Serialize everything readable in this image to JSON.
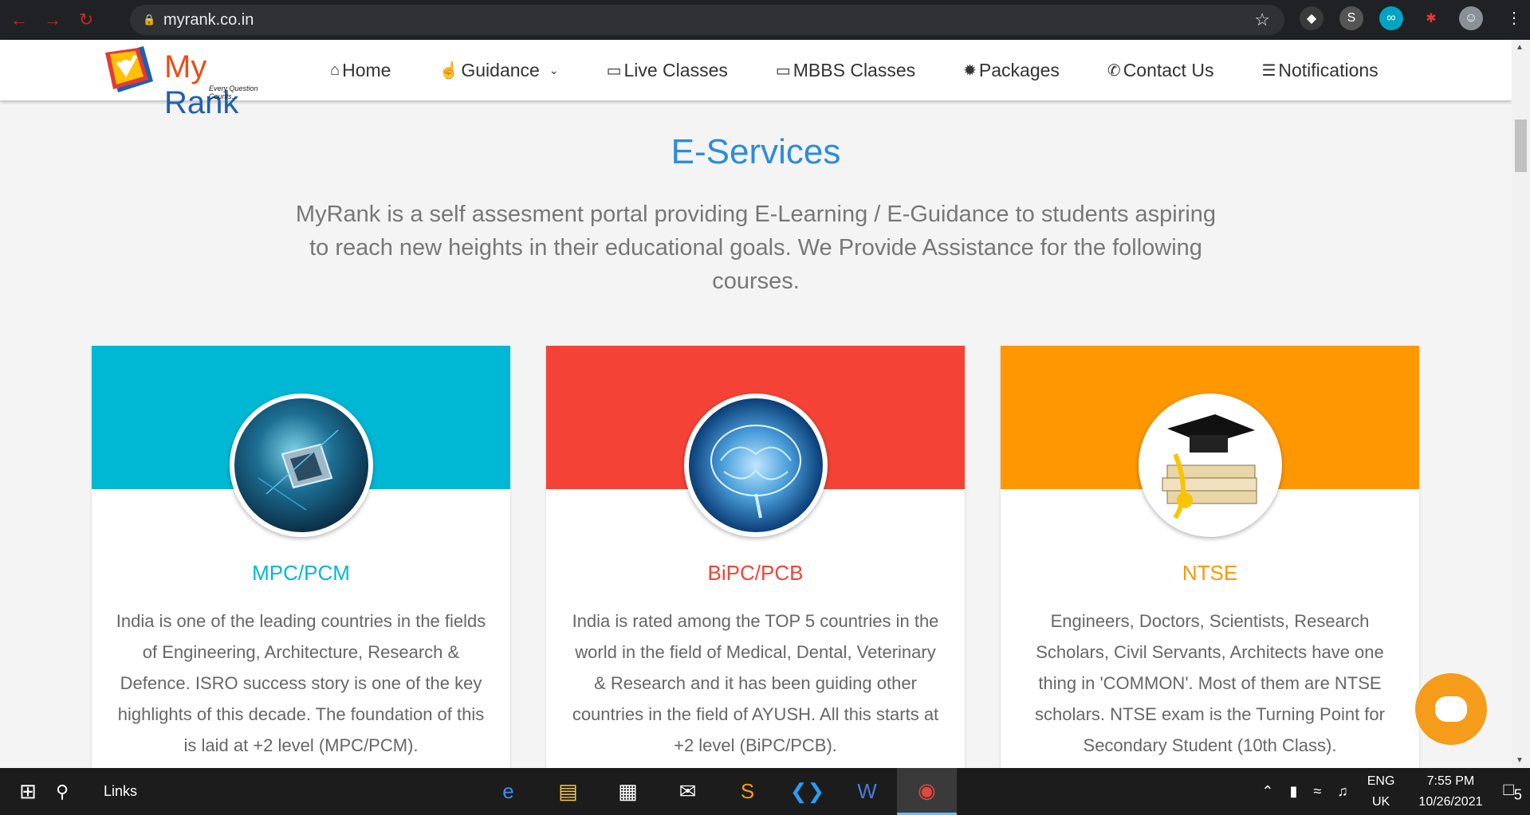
{
  "browser": {
    "url": "myrank.co.in"
  },
  "site": {
    "logo_my": "My",
    "logo_rank": "Rank",
    "logo_tagline": "Every Question Counts...",
    "menu": [
      {
        "label": "Home",
        "icon": "home-icon"
      },
      {
        "label": "Guidance",
        "icon": "thumbs-up-icon"
      },
      {
        "label": "Live Classes",
        "icon": "monitor-icon"
      },
      {
        "label": "MBBS Classes",
        "icon": "monitor-icon"
      },
      {
        "label": "Packages",
        "icon": "gear-icon"
      },
      {
        "label": "Contact Us",
        "icon": "phone-icon"
      },
      {
        "label": "Notifications",
        "icon": "list-icon"
      }
    ]
  },
  "main": {
    "heading": "E-Services",
    "intro": "MyRank is a self assesment portal providing E-Learning / E-Guidance to students aspiring to reach new heights in their educational goals. We Provide Assistance for the following courses.",
    "cards": [
      {
        "title": "MPC/PCM",
        "color": "#00b8d4",
        "body": "India is one of the leading countries in the fields of Engineering, Architecture, Research & Defence. ISRO success story is one of the key highlights of this decade. The foundation of this is laid at +2 level (MPC/PCM)."
      },
      {
        "title": "BiPC/PCB",
        "color": "#f44336",
        "body": "India is rated among the TOP 5 countries in the world in the field of Medical, Dental, Veterinary & Research and it has been guiding other countries in the field of AYUSH. All this starts at +2 level (BiPC/PCB)."
      },
      {
        "title": "NTSE",
        "color": "#ff9800",
        "body": "Engineers, Doctors, Scientists, Research Scholars, Civil Servants, Architects have one thing in 'COMMON'. Most of them are NTSE scholars. NTSE exam is the Turning Point for Secondary Student (10th Class)."
      }
    ]
  },
  "taskbar": {
    "links_label": "Links",
    "lang_top": "ENG",
    "lang_bottom": "UK",
    "time": "7:55 PM",
    "date": "10/26/2021",
    "notification_count": "5"
  }
}
